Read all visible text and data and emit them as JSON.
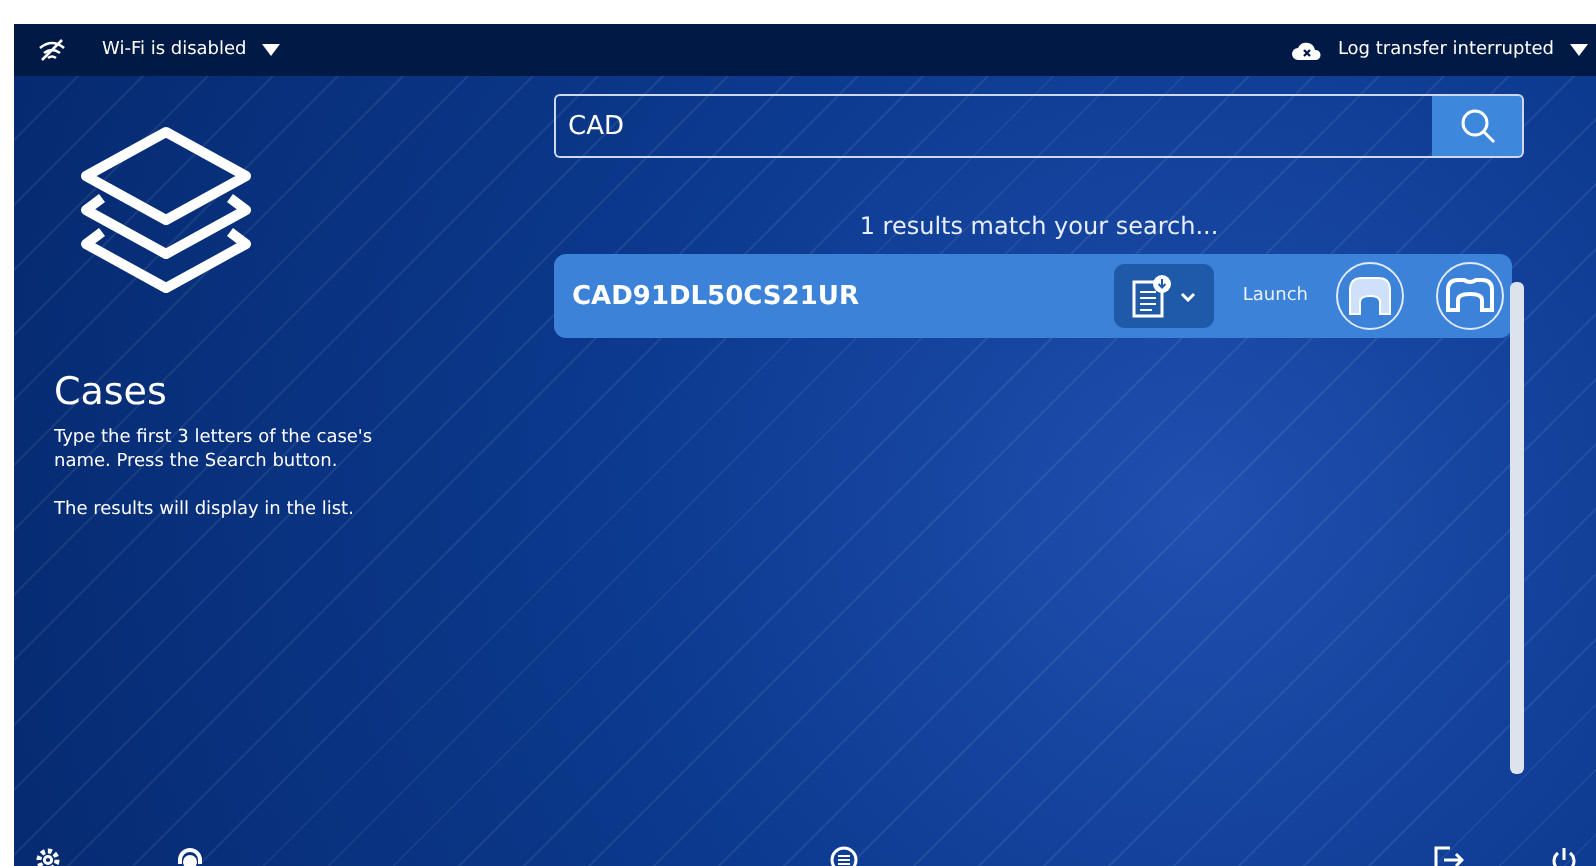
{
  "status_bar": {
    "wifi_label": "Wi-Fi is disabled",
    "log_label": "Log transfer interrupted"
  },
  "sidebar": {
    "title": "Cases",
    "instructions": [
      "Type the first 3 letters of the case's name. Press the Search button.",
      "The results will display in the list."
    ]
  },
  "search": {
    "value": "CAD"
  },
  "results_summary": "1 results match your search...",
  "results": [
    {
      "name": "CAD91DL50CS21UR",
      "launch_label": "Launch"
    }
  ]
}
